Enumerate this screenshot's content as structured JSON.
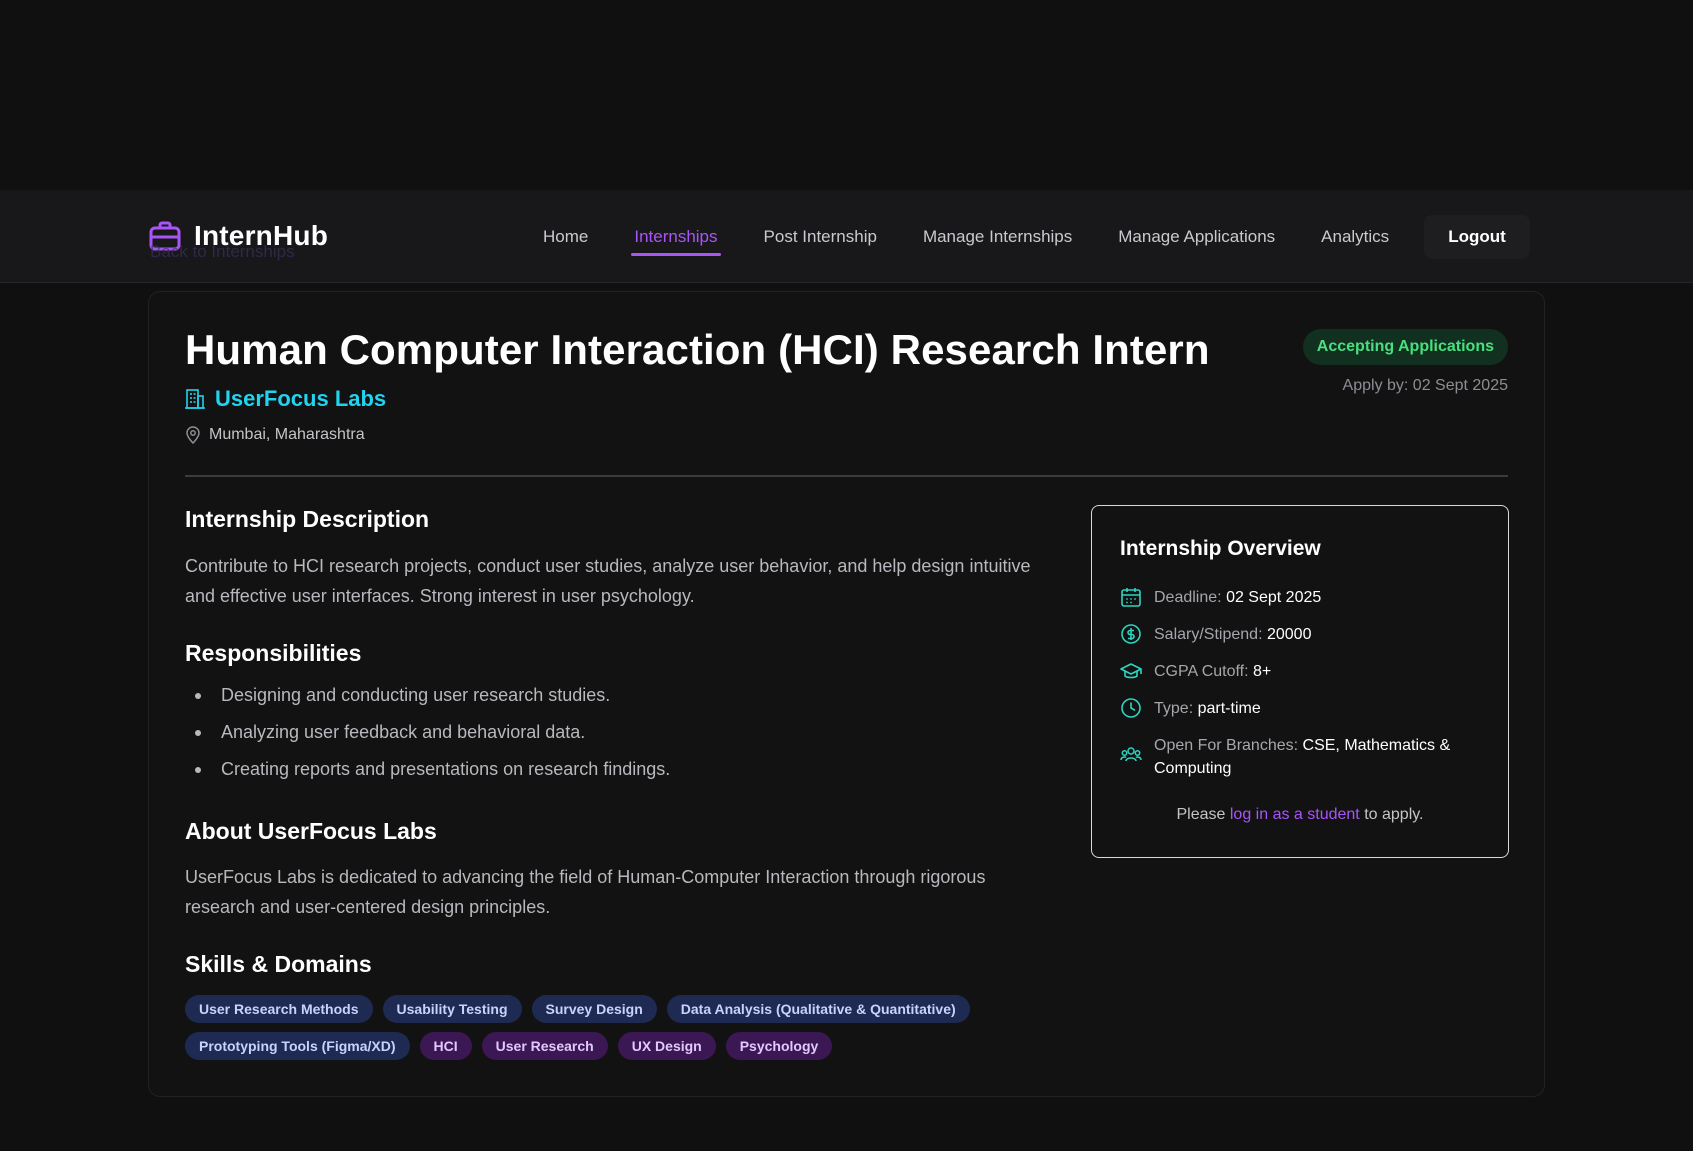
{
  "nav": {
    "brand": "InternHub",
    "back_link": "Back to Internships",
    "links": [
      "Home",
      "Internships",
      "Post Internship",
      "Manage Internships",
      "Manage Applications",
      "Analytics"
    ],
    "active": "Internships",
    "logout": "Logout"
  },
  "job": {
    "title": "Human Computer Interaction (HCI) Research Intern",
    "company": "UserFocus Labs",
    "location": "Mumbai, Maharashtra",
    "status": "Accepting Applications",
    "apply_by": "Apply by: 02 Sept 2025"
  },
  "description": {
    "heading": "Internship Description",
    "text": "Contribute to HCI research projects, conduct user studies, analyze user behavior, and help design intuitive and effective user interfaces. Strong interest in user psychology."
  },
  "responsibilities": {
    "heading": "Responsibilities",
    "items": [
      "Designing and conducting user research studies.",
      "Analyzing user feedback and behavioral data.",
      "Creating reports and presentations on research findings."
    ]
  },
  "about": {
    "heading": "About UserFocus Labs",
    "text": "UserFocus Labs is dedicated to advancing the field of Human-Computer Interaction through rigorous research and user-centered design principles."
  },
  "skills": {
    "heading": "Skills & Domains",
    "skill_tags": [
      "User Research Methods",
      "Usability Testing",
      "Survey Design",
      "Data Analysis (Qualitative & Quantitative)",
      "Prototyping Tools (Figma/XD)"
    ],
    "domain_tags": [
      "HCI",
      "User Research",
      "UX Design",
      "Psychology"
    ]
  },
  "overview": {
    "heading": "Internship Overview",
    "rows": [
      {
        "label": "Deadline:",
        "value": "02 Sept 2025",
        "icon": "calendar-icon"
      },
      {
        "label": "Salary/Stipend:",
        "value": "20000",
        "icon": "dollar-icon"
      },
      {
        "label": "CGPA Cutoff:",
        "value": "8+",
        "icon": "graduation-cap-icon"
      },
      {
        "label": "Type:",
        "value": "part-time",
        "icon": "clock-icon"
      },
      {
        "label": "Open For Branches:",
        "value": "CSE, Mathematics & Computing",
        "icon": "users-icon"
      }
    ],
    "apply_prefix": "Please",
    "apply_link": "log in as a student",
    "apply_suffix": "to apply."
  },
  "colors": {
    "accent": "#a855f7",
    "company": "#22d3ee",
    "status_text": "#4ade80",
    "status_bg": "#12301f",
    "icon": "#2dd4bf"
  }
}
